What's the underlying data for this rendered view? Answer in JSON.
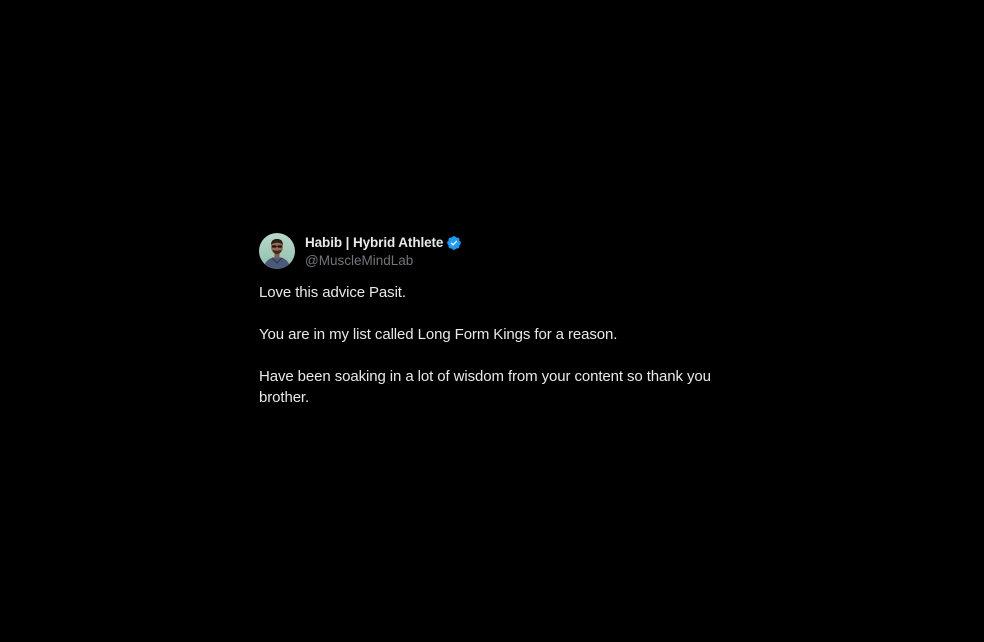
{
  "tweet": {
    "author": {
      "display_name": "Habib | Hybrid Athlete",
      "handle": "@MuscleMindLab",
      "verified": true,
      "avatar_icon": "person-photo-avatar",
      "badge_icon": "verified-badge-icon",
      "badge_color": "#1d9bf0"
    },
    "paragraphs": [
      "Love this advice Pasit.",
      "You are in my list called Long Form Kings for a reason.",
      "Have been soaking in a lot of wisdom from your content so thank you brother."
    ]
  },
  "theme": {
    "background": "#000000",
    "primary_text": "#e7e9ea",
    "secondary_text": "#71767b"
  }
}
